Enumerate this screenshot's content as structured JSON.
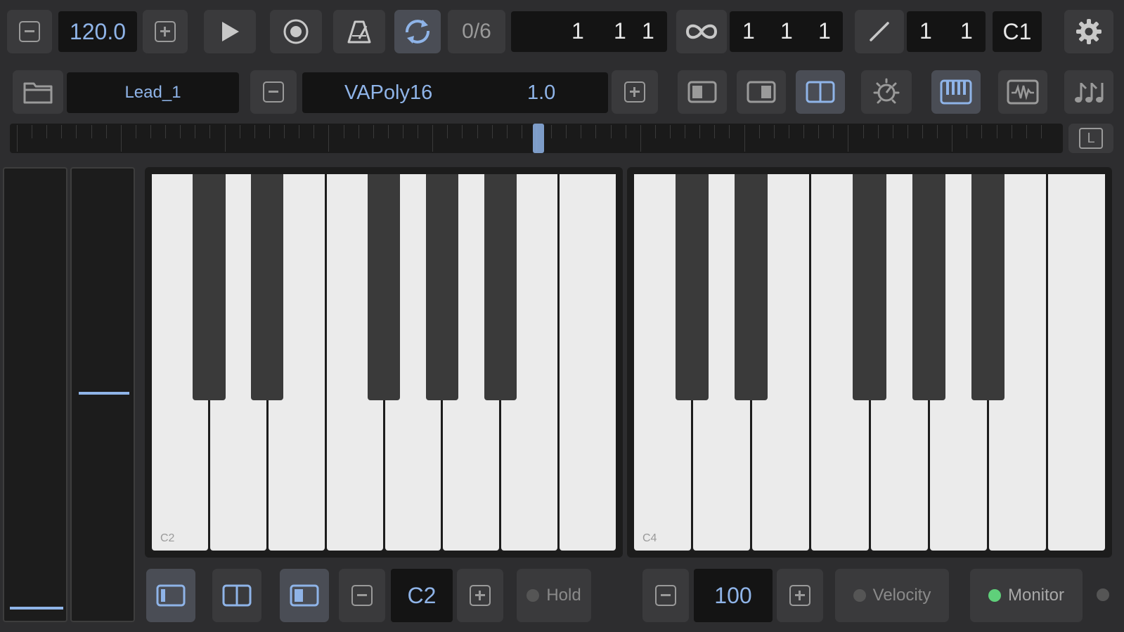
{
  "transport": {
    "tempo": "120.0",
    "pattern_counter": "0/6",
    "position": [
      "1",
      "1",
      "1"
    ],
    "loop_position": [
      "1",
      "1",
      "1"
    ],
    "pencil_values": [
      "1",
      "1"
    ],
    "key": "C1"
  },
  "instrument": {
    "preset_name": "Lead_1",
    "synth_name": "VAPoly16",
    "synth_value": "1.0"
  },
  "scroll_lock_label": "L",
  "keyboard": {
    "labels": [
      "C2",
      "C4"
    ]
  },
  "bottom": {
    "octave": "C2",
    "hold_label": "Hold",
    "velocity_value": "100",
    "velocity_label": "Velocity",
    "monitor_label": "Monitor"
  },
  "colors": {
    "accent": "#8fb4e8",
    "monitor_on": "#5fd07a",
    "background": "#2d2d2f"
  }
}
